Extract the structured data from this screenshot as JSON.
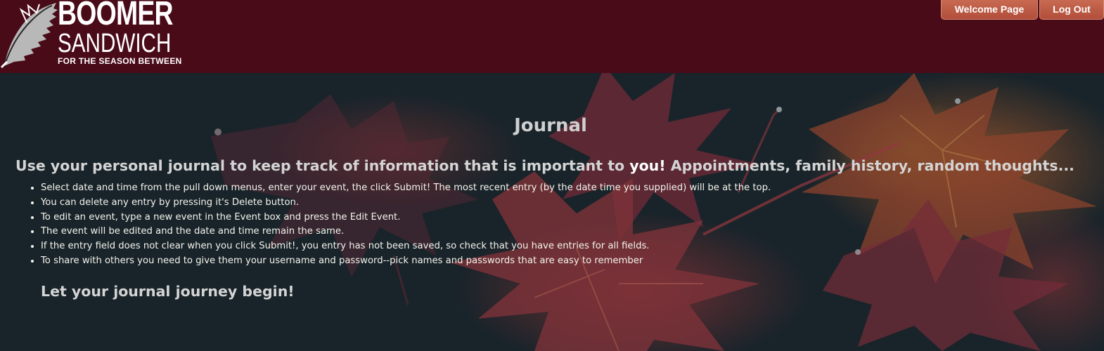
{
  "header": {
    "logo": {
      "line1": "BOOMER",
      "line2": "SANDWICH",
      "tagline": "FOR THE SEASON BETWEEN"
    },
    "nav": {
      "welcome_label": "Welcome Page",
      "logout_label": "Log Out"
    },
    "colors": {
      "header_bg": "#4a0b19",
      "button_bg": "#b9543f"
    }
  },
  "main": {
    "title": "Journal",
    "intro_prefix": "Use your personal journal to keep track of information that is important to ",
    "intro_emphasis": "you!",
    "intro_suffix": " Appointments, family history, random thoughts...",
    "instructions": [
      "Select date and time from the pull down menus, enter your event, the click Submit! The most recent entry (by the date time you supplied) will be at the top.",
      "You can delete any entry by pressing it's Delete button.",
      "To edit an event, type a new event in the Event box and press the Edit Event.",
      "The event will be edited and the date and time remain the same.",
      "If the entry field does not clear when you click Submit!, you entry has not been saved, so check that you have entries for all fields.",
      "To share with others you need to give them your username and password--pick names and passwords that are easy to remember"
    ],
    "closing": "Let your journal journey begin!"
  }
}
